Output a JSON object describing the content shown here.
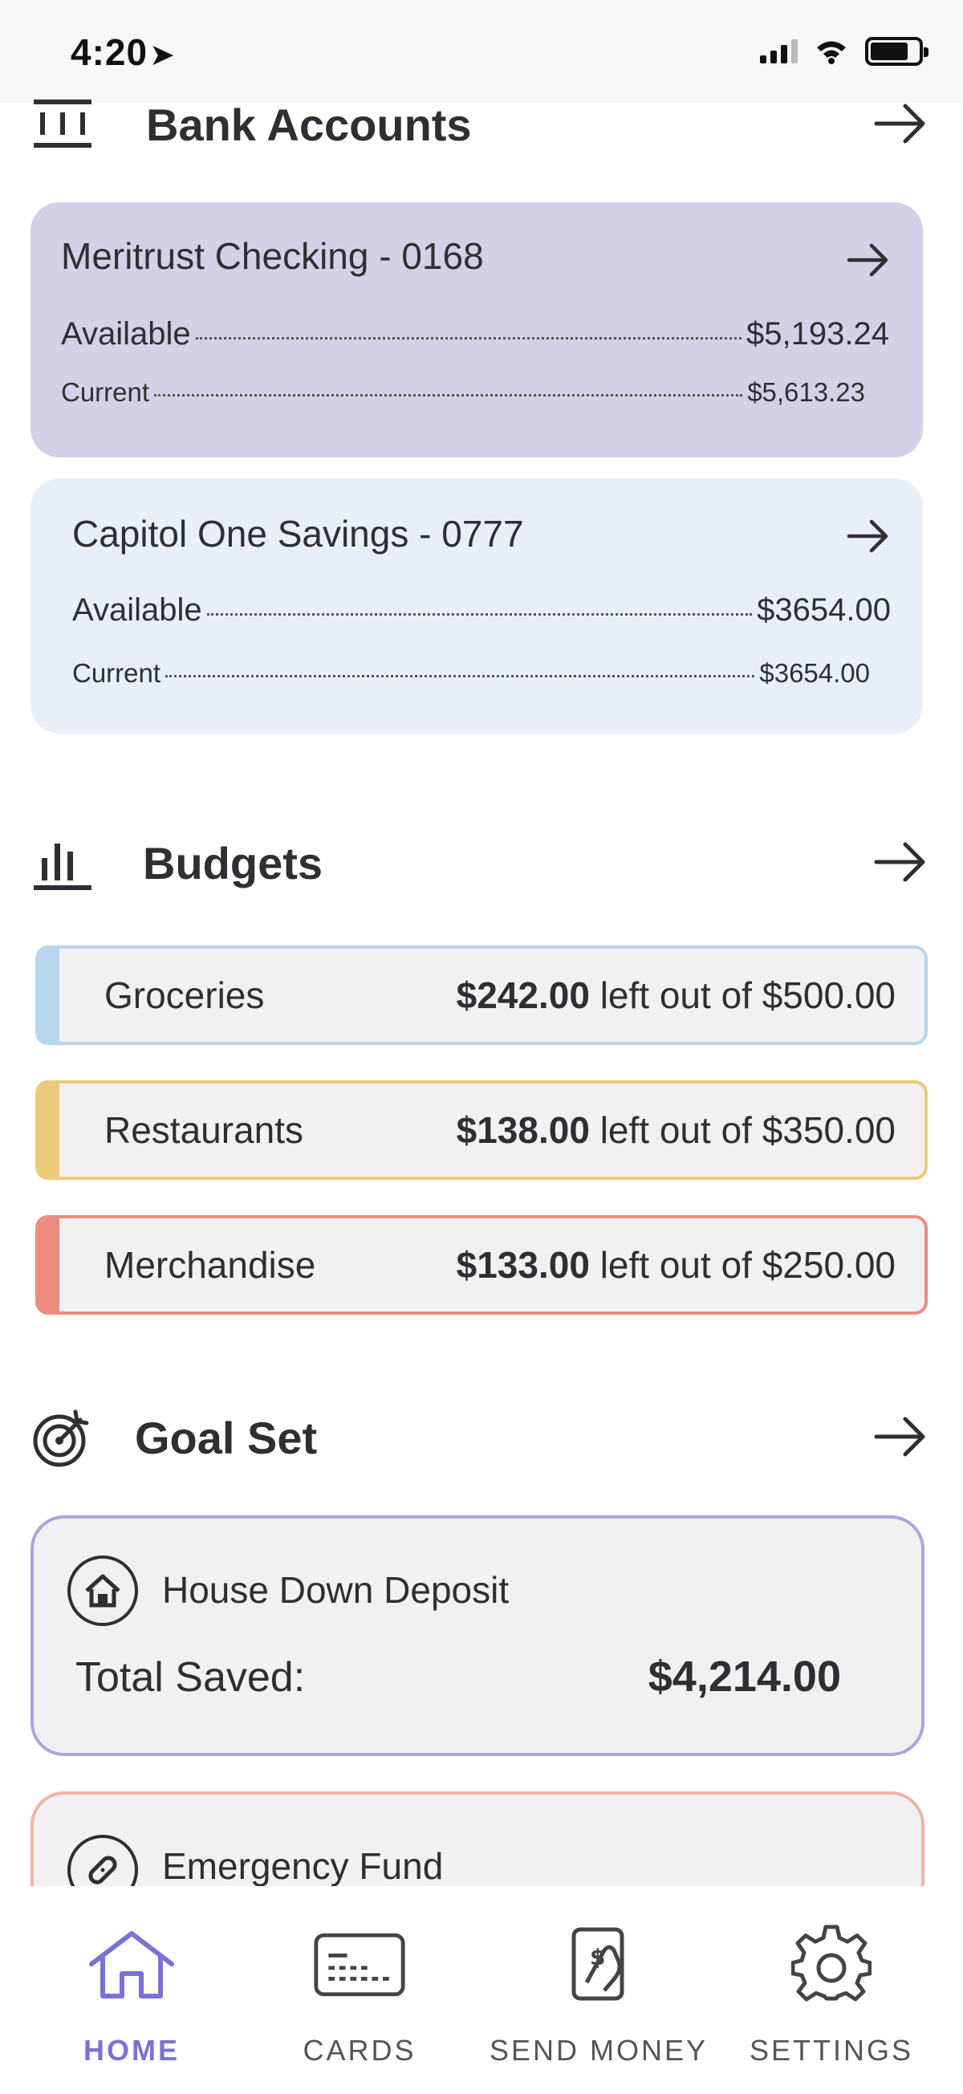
{
  "status_bar": {
    "time": "4:20",
    "location_glyph": "➤"
  },
  "bank_accounts": {
    "title": "Bank Accounts",
    "accounts": [
      {
        "name": "Meritrust Checking - 0168",
        "available_label": "Available",
        "available_value": "$5,193.24",
        "current_label": "Current",
        "current_value": "$5,613.23",
        "color": "#d4d0e8"
      },
      {
        "name": "Capitol One Savings - 0777",
        "available_label": "Available",
        "available_value": "$3654.00",
        "current_label": "Current",
        "current_value": "$3654.00",
        "color": "#e9eff9"
      }
    ]
  },
  "budgets": {
    "title": "Budgets",
    "items": [
      {
        "name": "Groceries",
        "left": "$242.00",
        "suffix": "left out of $500.00",
        "color": "#b6d6ee"
      },
      {
        "name": "Restaurants",
        "left": "$138.00",
        "suffix": "left out of $350.00",
        "color": "#ebcb7a"
      },
      {
        "name": "Merchandise",
        "left": "$133.00",
        "suffix": "left out of $250.00",
        "color": "#ec8b80"
      }
    ]
  },
  "goals": {
    "title": "Goal Set",
    "items": [
      {
        "name": "House Down Deposit",
        "total_label": "Total Saved:",
        "total_value": "$4,214.00",
        "icon": "house-icon",
        "color": "#aaa4e0"
      },
      {
        "name": "Emergency Fund",
        "icon": "bandage-icon",
        "color": "#f0b3a8"
      }
    ]
  },
  "tabbar": {
    "accent": "#7a72d4",
    "tabs": [
      {
        "label": "HOME",
        "icon": "home-icon",
        "active": true
      },
      {
        "label": "CARDS",
        "icon": "card-icon",
        "active": false
      },
      {
        "label": "SEND MONEY",
        "icon": "send-money-icon",
        "active": false
      },
      {
        "label": "SETTINGS",
        "icon": "gear-icon",
        "active": false
      }
    ]
  }
}
